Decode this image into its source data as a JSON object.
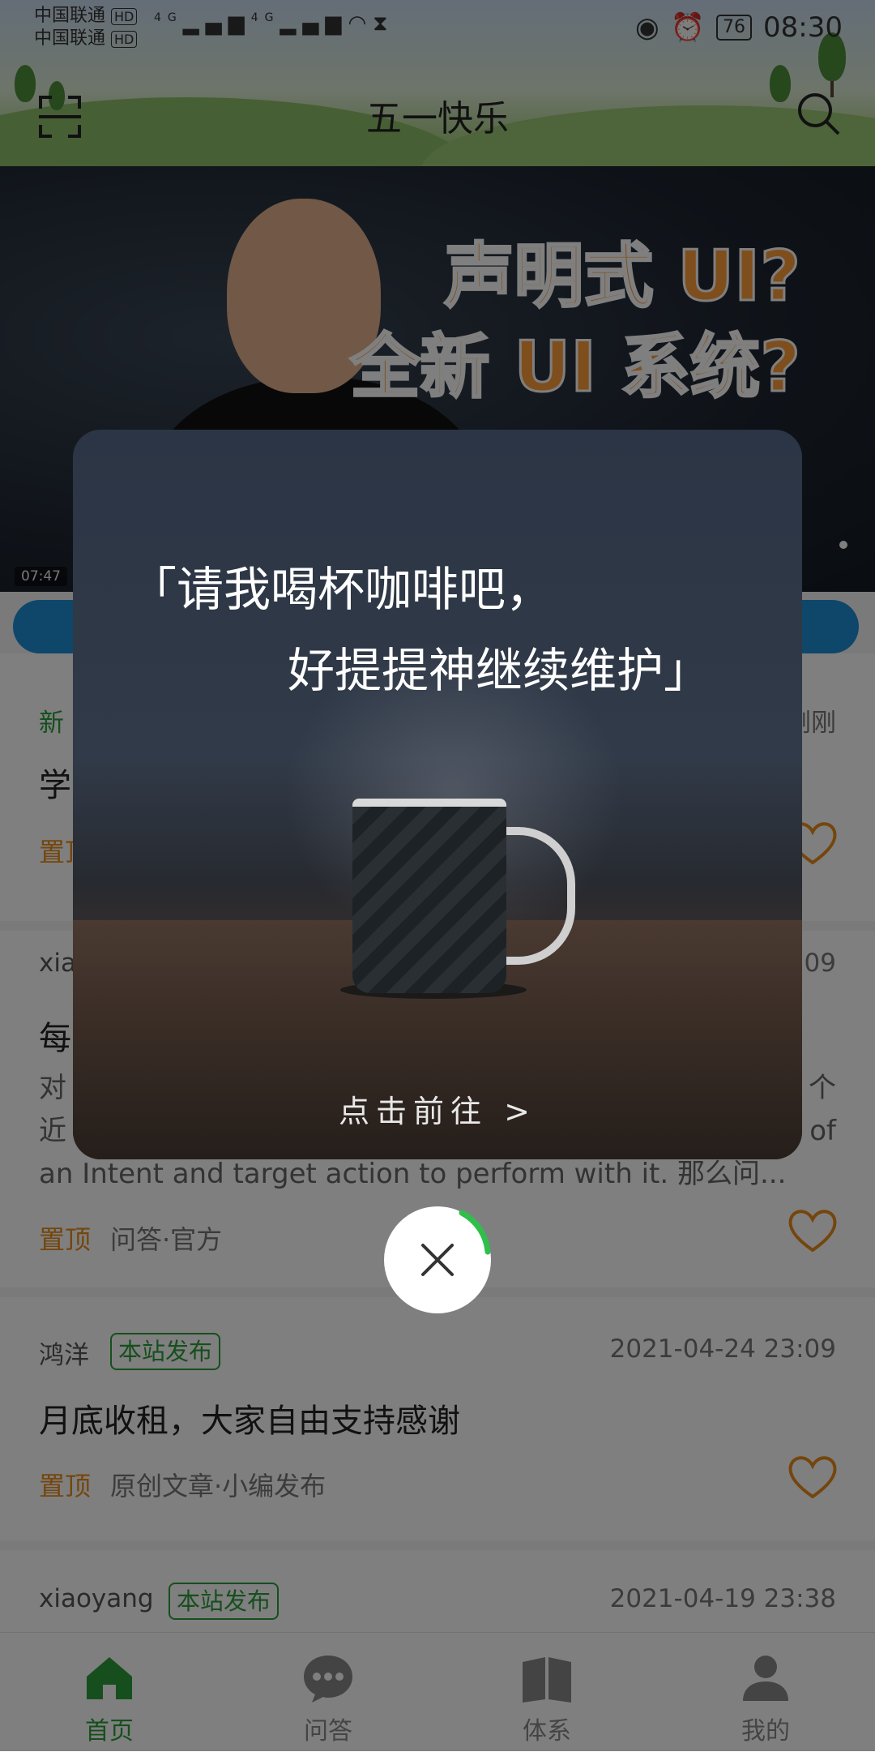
{
  "status_bar": {
    "carrier_1": "中国联通",
    "carrier_2": "中国联通",
    "hd": "HD",
    "net_1": "4G",
    "net_2": "4G",
    "battery": "76",
    "time": "08:30"
  },
  "header": {
    "title": "五一快乐",
    "scan_icon": "scan-icon",
    "search_icon": "search-icon"
  },
  "banner": {
    "headline_1": "声明式 UI?",
    "headline_2": "全新 UI 系统?",
    "duration": "07:47"
  },
  "feed": [
    {
      "label": "新",
      "time": "刚刚",
      "title": "学",
      "pin": "置顶"
    },
    {
      "author": "xia",
      "time": "09",
      "title": "每",
      "desc_line_1": "对",
      "desc_line_1_end": "个",
      "desc_line_2": "近",
      "desc_line_2_end": "of",
      "desc_line_3": "an Intent and target action to perform with it. 那么问...",
      "pin": "置顶",
      "category": "问答·官方"
    },
    {
      "author": "鸿洋",
      "badge": "本站发布",
      "time": "2021-04-24 23:09",
      "title": "月底收租，大家自由支持感谢",
      "pin": "置顶",
      "category": "原创文章·小编发布"
    },
    {
      "author": "xiaoyang",
      "badge": "本站发布",
      "time": "2021-04-19 23:38"
    }
  ],
  "bottom_nav": [
    {
      "label": "首页",
      "icon": "home-icon",
      "active": true
    },
    {
      "label": "问答",
      "icon": "chat-icon",
      "active": false
    },
    {
      "label": "体系",
      "icon": "book-icon",
      "active": false
    },
    {
      "label": "我的",
      "icon": "user-icon",
      "active": false
    }
  ],
  "dialog": {
    "line_1": "「请我喝杯咖啡吧，",
    "line_2": "好提提神继续维护」",
    "cta": "点击前往 >",
    "close_icon": "close-icon"
  },
  "colors": {
    "accent": "#2d9e3a",
    "pin": "#e88c1a",
    "banner_text": "#ff9d3b",
    "tag_bar": "#1f8fd6"
  }
}
